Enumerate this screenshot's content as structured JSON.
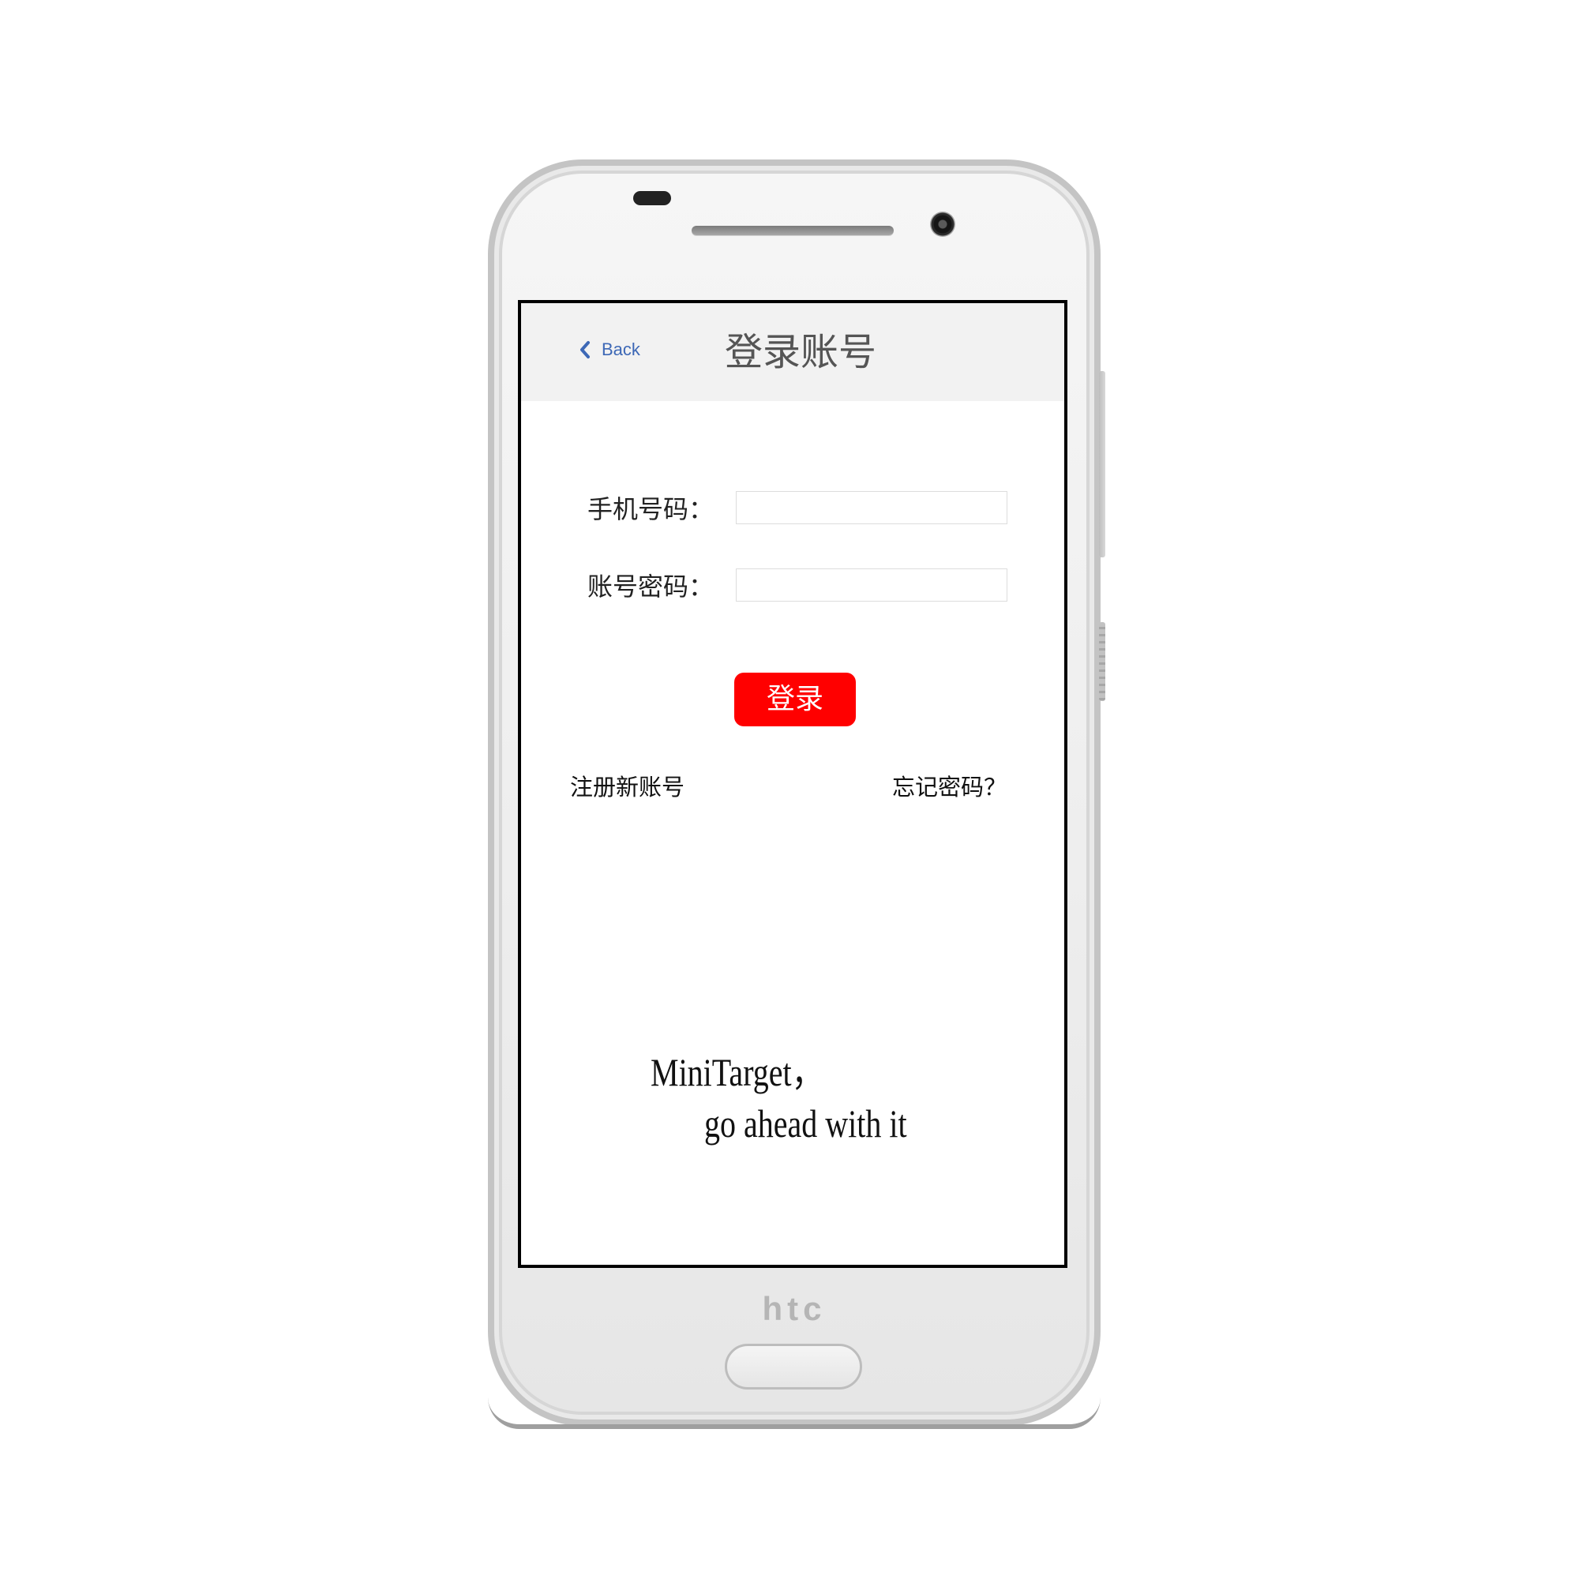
{
  "nav": {
    "back_label": "Back",
    "title": "登录账号"
  },
  "form": {
    "phone_label": "手机号码：",
    "phone_value": "",
    "password_label": "账号密码：",
    "password_value": ""
  },
  "login_button_label": "登录",
  "links": {
    "register": "注册新账号",
    "forgot_password": "忘记密码？"
  },
  "slogan": {
    "line1": "MiniTarget，",
    "line2": "go ahead with it"
  },
  "device": {
    "brand": "htc"
  },
  "colors": {
    "accent_red": "#ff0000",
    "back_link_blue": "#3d68b6",
    "navbar_bg": "#f2f2f2"
  },
  "icons": {
    "back": "chevron-left-icon"
  }
}
